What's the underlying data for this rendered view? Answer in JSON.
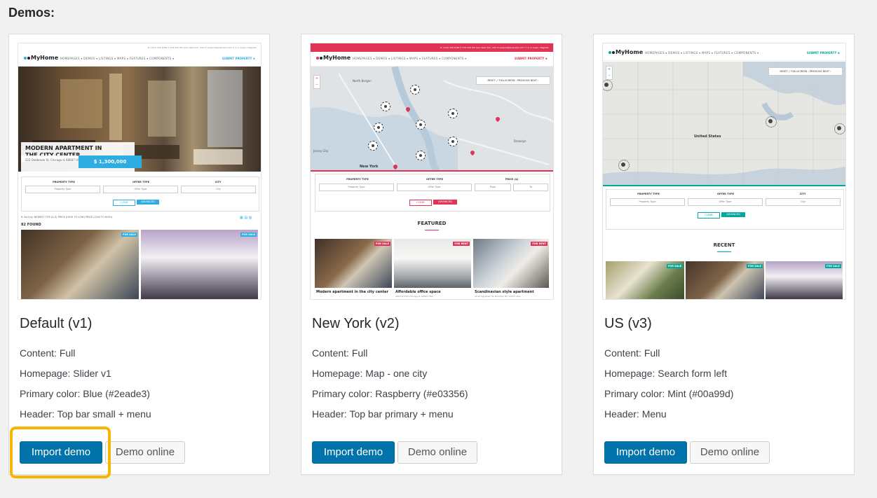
{
  "page": {
    "title": "Demos:"
  },
  "demos": [
    {
      "title": "Default (v1)",
      "content": "Content: Full",
      "homepage": "Homepage: Slider v1",
      "primary_color": "Primary color: Blue (#2eade3)",
      "header": "Header: Top bar small + menu",
      "import_label": "Import demo",
      "online_label": "Demo online",
      "accent": "#2eade3",
      "preview": {
        "logo": "MyHome",
        "nav": "HOMEPAGES ▾   DEMOS ▾   LISTINGS ▾   MAPS ▾   FEATURES ▾   COMPONENTS ▾",
        "submit": "SUBMIT PROPERTY ⊕",
        "topbar": "☏ (123) 345-6789   ⚲ 378-520 5th Ave, New York, USA   ✉ support@example.net   f  ✦  ◎  in   Login / Register",
        "caption_line1": "MODERN APARTMENT IN",
        "caption_line2": "THE CITY CENTER",
        "address": "222 Oakbrook St, Chicago IL 60607 USA",
        "price": "$ 1,300,000",
        "labels": [
          "PROPERTY TYPE",
          "OFFER TYPE",
          "CITY"
        ],
        "fields": [
          "Property Type",
          "Offer Type",
          "City"
        ],
        "clear": "CLEAR",
        "advanced": "ADVANCED",
        "sortbar": "⇅ Sort by:  NEWEST    TOP (A-Z)    PRICE (HIGH TO LOW)    PRICE (LOW TO HIGH)",
        "found": "82 FOUND",
        "tag": "FOR SALE"
      }
    },
    {
      "title": "New York (v2)",
      "content": "Content: Full",
      "homepage": "Homepage: Map - one city",
      "primary_color": "Primary color: Raspberry (#e03356)",
      "header": "Header: Top bar primary + menu",
      "import_label": "Import demo",
      "online_label": "Demo online",
      "accent": "#e03356",
      "preview": {
        "logo": "MyHome",
        "nav": "HOMEPAGES ▾   DEMOS ▾   LISTINGS ▾   MAPS ▾   FEATURES ▾   COMPONENTS ▾",
        "submit": "SUBMIT PROPERTY ⊕",
        "topbar": "☏ (123) 345-6789   ⚲ 378-520 5th Ave, New York, USA   ✉ support@example.net   f  ✦  ◎  in   Login / Register",
        "map_controls": "RESET   ⤢ FULLSCREEN   ‹ PREVIOUS   NEXT ›",
        "city_labels": [
          "North Bergen",
          "Jersey City",
          "New York",
          "Brooklyn"
        ],
        "labels": [
          "PROPERTY TYPE",
          "OFFER TYPE",
          "PRICE ($)"
        ],
        "fields": [
          "Property Type",
          "Offer Type",
          "From",
          "To"
        ],
        "clear": "CLEAR",
        "advanced": "ADVANCED",
        "section": "FEATURED",
        "tiles": [
          {
            "tag": "FOR SALE",
            "title": "Modern apartment in the city center",
            "addr": "2226 Oakbrook St, Chicago IL 60607 USA"
          },
          {
            "tag": "FOR RENT",
            "title": "Affordable office space",
            "addr": "4414 W 57th Chicago IL 60612 USA"
          },
          {
            "tag": "FOR RENT",
            "title": "Scandinavian style apartment",
            "addr": "44 W Ingraham St, Brooklyn NY 11237 USA"
          }
        ]
      }
    },
    {
      "title": "US (v3)",
      "content": "Content: Full",
      "homepage": "Homepage: Search form left",
      "primary_color": "Primary color: Mint (#00a99d)",
      "header": "Header: Menu",
      "import_label": "Import demo",
      "online_label": "Demo online",
      "accent": "#00a99d",
      "preview": {
        "logo": "MyHome",
        "nav": "HOMEPAGES ▾   DEMOS ▾   LISTINGS ▾   MAPS ▾   FEATURES ▾   COMPONENTS ▾",
        "submit": "SUBMIT PROPERTY ⊕",
        "map_controls": "RESET   ⤢ FULLSCREEN   ‹ PREVIOUS   NEXT ›",
        "country_label": "United States",
        "labels": [
          "PROPERTY TYPE",
          "OFFER TYPE",
          "CITY"
        ],
        "fields": [
          "Property Type",
          "Offer Type",
          "City"
        ],
        "clear": "CLEAR",
        "advanced": "ADVANCED",
        "section": "RECENT",
        "tag": "FOR SALE"
      }
    }
  ]
}
